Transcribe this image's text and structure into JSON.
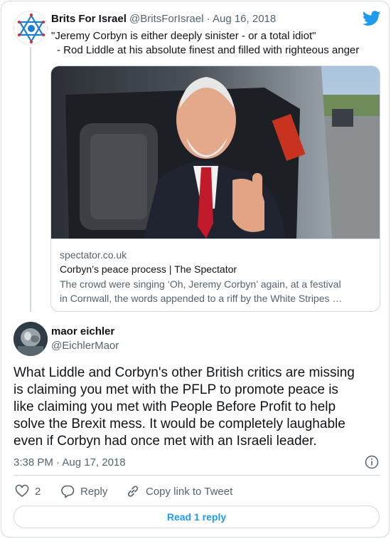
{
  "parent_tweet": {
    "author_name": "Brits For Israel",
    "author_handle": "@BritsForIsrael",
    "separator": "·",
    "date": "Aug 16, 2018",
    "text_line1": "\"Jeremy Corbyn is either deeply sinister - or a total idiot\"",
    "text_line2": "- Rod Liddle at his absolute finest and filled with righteous anger",
    "link_card": {
      "domain": "spectator.co.uk",
      "title": "Corbyn’s peace process | The Spectator",
      "description_line1": "The crowd were singing ‘Oh, Jeremy Corbyn’ again, at a festival",
      "description_line2": "in Cornwall, the words appended to a riff by the White Stripes …"
    }
  },
  "tweet": {
    "author_name": "maor eichler",
    "author_handle": "@EichlerMaor",
    "body_lines": [
      "What Liddle and Corbyn's other British critics are missing",
      "is claiming you met with the PFLP to promote peace is",
      "like claiming you met with People Before Profit to help",
      "solve the Brexit mess. It would be completely laughable",
      "even if Corbyn had once met with an Israeli leader."
    ],
    "timestamp": "3:38 PM · Aug 17, 2018",
    "likes_count": "2",
    "reply_label": "Reply",
    "copy_link_label": "Copy link to Tweet",
    "read_replies_label": "Read 1 reply"
  },
  "colors": {
    "accent": "#1d9bf0",
    "text_secondary": "#536471",
    "border": "#cfd9de"
  },
  "icons": [
    "star-of-david-logo",
    "twitter-bird-icon",
    "info-icon",
    "heart-icon",
    "reply-icon",
    "link-icon"
  ]
}
